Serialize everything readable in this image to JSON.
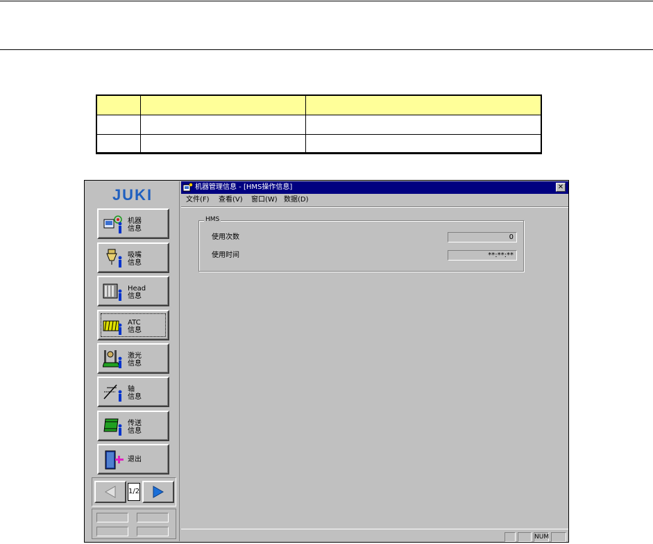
{
  "sidebar": {
    "logo_text": "JUKI",
    "buttons": [
      {
        "label": "机器\n信息",
        "icon": "machine-info-icon"
      },
      {
        "label": "吸嘴\n信息",
        "icon": "nozzle-info-icon"
      },
      {
        "label": "Head\n信息",
        "icon": "head-info-icon"
      },
      {
        "label": "ATC\n信息",
        "icon": "atc-info-icon"
      },
      {
        "label": "激光\n信息",
        "icon": "laser-info-icon"
      },
      {
        "label": "轴\n信息",
        "icon": "axis-info-icon"
      },
      {
        "label": "传送\n信息",
        "icon": "conveyor-info-icon"
      },
      {
        "label": "退出",
        "icon": "exit-icon"
      }
    ],
    "page_indicator": "1/2"
  },
  "window": {
    "title": "机器管理信息 - [HMS操作信息]",
    "menu": [
      "文件(F)",
      "查看(V)",
      "窗口(W)",
      "数据(D)"
    ],
    "group_title": "HMS",
    "fields": [
      {
        "label": "使用次数",
        "value": "0"
      },
      {
        "label": "使用时间",
        "value": "**:**:**"
      }
    ],
    "status_cells": [
      "",
      "",
      "NUM",
      ""
    ]
  },
  "colors": {
    "title_bar": "#000080",
    "table_header": "#ffff99",
    "face": "#c0c0c0",
    "arrow": "#1a6fd8"
  }
}
